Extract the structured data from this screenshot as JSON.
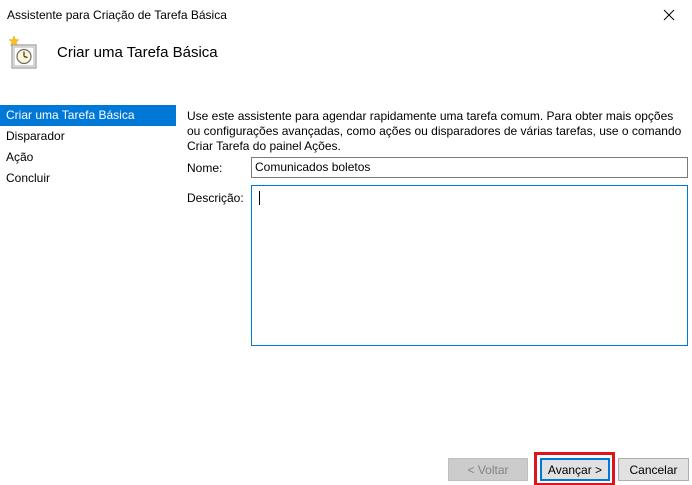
{
  "window": {
    "title": "Assistente para Criação de Tarefa Básica",
    "close_icon": "close-icon"
  },
  "header": {
    "title": "Criar uma Tarefa Básica",
    "icon": "task-scheduler-clock-icon"
  },
  "steps": [
    {
      "label": "Criar uma Tarefa Básica",
      "active": true
    },
    {
      "label": "Disparador",
      "active": false
    },
    {
      "label": "Ação",
      "active": false
    },
    {
      "label": "Concluir",
      "active": false
    }
  ],
  "main": {
    "description": "Use este assistente para agendar rapidamente uma tarefa comum. Para obter mais opções ou configurações avançadas, como ações ou disparadores de várias tarefas, use o comando Criar Tarefa do painel Ações.",
    "name_label": "Nome:",
    "name_value": "Comunicados boletos",
    "description_label": "Descrição:",
    "description_value": ""
  },
  "buttons": {
    "back": "< Voltar",
    "next": "Avançar >",
    "cancel": "Cancelar"
  },
  "colors": {
    "accent": "#0078d7",
    "highlight_outline": "#e0121b"
  }
}
